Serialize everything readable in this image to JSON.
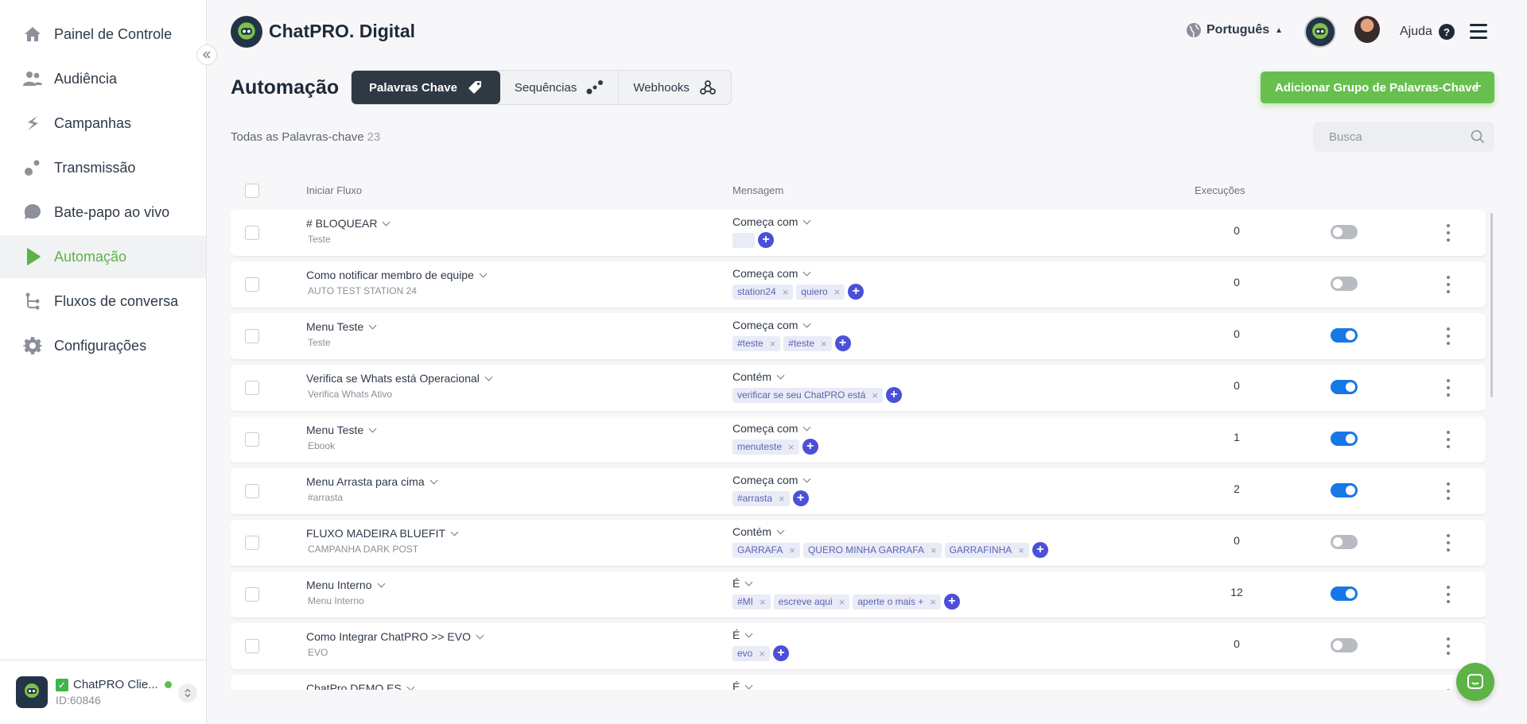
{
  "sidebar": {
    "items": [
      {
        "label": "Painel de Controle",
        "icon": "home-icon"
      },
      {
        "label": "Audiência",
        "icon": "users-icon"
      },
      {
        "label": "Campanhas",
        "icon": "campaigns-icon"
      },
      {
        "label": "Transmissão",
        "icon": "broadcast-icon"
      },
      {
        "label": "Bate-papo ao vivo",
        "icon": "chat-bubble-icon"
      },
      {
        "label": "Automação",
        "icon": "play-icon"
      },
      {
        "label": "Fluxos de conversa",
        "icon": "flow-icon"
      },
      {
        "label": "Configurações",
        "icon": "gear-icon"
      }
    ],
    "active_index": 5,
    "account": {
      "name": "ChatPRO Clie...",
      "id": "ID:60846",
      "logo_text": "ChatPRO"
    }
  },
  "header": {
    "brand": "ChatPRO. Digital",
    "language": "Português",
    "help": "Ajuda",
    "help_icon": "?"
  },
  "page": {
    "title": "Automação",
    "tabs": [
      {
        "label": "Palavras Chave",
        "icon": "tag-icon",
        "active": true
      },
      {
        "label": "Sequências",
        "icon": "sequence-icon",
        "active": false
      },
      {
        "label": "Webhooks",
        "icon": "webhook-icon",
        "active": false
      }
    ],
    "add_group_label": "Adicionar Grupo de Palavras-Chave",
    "add_group_plus": "+",
    "total_label": "Todas as Palavras-chave",
    "total_count": "23",
    "search_placeholder": "Busca"
  },
  "table": {
    "headers": {
      "flow": "Iniciar Fluxo",
      "message": "Mensagem",
      "executions": "Execuções"
    },
    "rows": [
      {
        "title": "# BLOQUEAR",
        "sub": "Teste",
        "cond": "Começa com",
        "tags": [
          ""
        ],
        "exec": "0",
        "on": false
      },
      {
        "title": "Como notificar membro de equipe",
        "sub": "AUTO TEST STATION 24",
        "cond": "Começa com",
        "tags": [
          "station24",
          "quiero"
        ],
        "exec": "0",
        "on": false
      },
      {
        "title": "Menu Teste",
        "sub": "Teste",
        "cond": "Começa com",
        "tags": [
          "#teste",
          "#teste"
        ],
        "exec": "0",
        "on": true
      },
      {
        "title": "Verifica se Whats está Operacional",
        "sub": "Verifica Whats Ativo",
        "cond": "Contém",
        "tags": [
          "verificar se seu ChatPRO está"
        ],
        "exec": "0",
        "on": true
      },
      {
        "title": "Menu Teste",
        "sub": "Ebook",
        "cond": "Começa com",
        "tags": [
          "menuteste"
        ],
        "exec": "1",
        "on": true
      },
      {
        "title": "Menu Arrasta para cima",
        "sub": "#arrasta",
        "cond": "Começa com",
        "tags": [
          "#arrasta"
        ],
        "exec": "2",
        "on": true
      },
      {
        "title": "FLUXO MADEIRA BLUEFIT",
        "sub": "CAMPANHA DARK POST",
        "cond": "Contém",
        "tags": [
          "GARRAFA",
          "QUERO MINHA GARRAFA",
          "GARRAFINHA"
        ],
        "exec": "0",
        "on": false
      },
      {
        "title": "Menu Interno",
        "sub": "Menu Interno",
        "cond": "É",
        "tags": [
          "#MI",
          "escreve aqui",
          "aperte o mais +"
        ],
        "exec": "12",
        "on": true
      },
      {
        "title": "Como Integrar ChatPRO >> EVO",
        "sub": "EVO",
        "cond": "É",
        "tags": [
          "evo"
        ],
        "exec": "0",
        "on": false
      },
      {
        "title": "ChatPro DEMO ES",
        "sub": "",
        "cond": "É",
        "tags": [],
        "exec": "",
        "on": true
      }
    ]
  },
  "colors": {
    "accent": "#5db346",
    "tag_add": "#4b50d8",
    "toggle_on": "#1677e6"
  }
}
